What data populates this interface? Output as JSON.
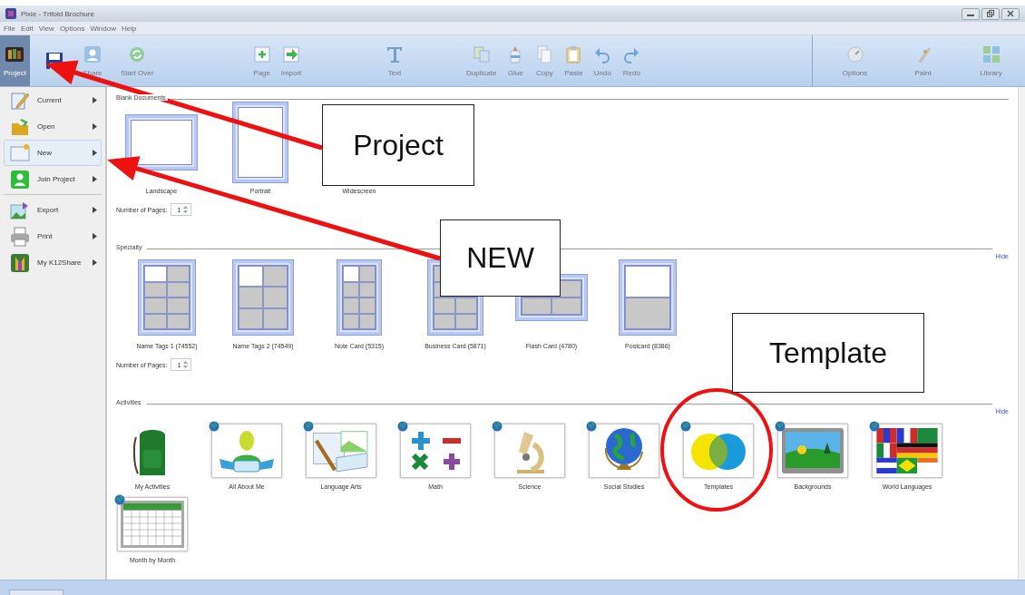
{
  "window": {
    "title": "Pixie - Trifold Brochure"
  },
  "menu": [
    "File",
    "Edit",
    "View",
    "Options",
    "Window",
    "Help"
  ],
  "toolbar": {
    "groups": [
      [
        {
          "label": "Project",
          "selected": true
        },
        {
          "selected": false
        },
        {
          "label": "Share",
          "selected": false
        },
        {
          "label": "Start Over",
          "selected": false
        }
      ],
      [
        {
          "label": "Page",
          "selected": false
        },
        {
          "label": "Import",
          "selected": false
        }
      ],
      [
        {
          "label": "Text",
          "selected": false
        }
      ],
      [
        {
          "label": "Duplicate",
          "selected": false
        },
        {
          "label": "Glue",
          "selected": false
        },
        {
          "label": "Copy",
          "selected": false
        },
        {
          "label": "Paste",
          "selected": false
        },
        {
          "label": "Undo",
          "selected": false
        },
        {
          "label": "Redo",
          "selected": false
        }
      ],
      [
        {
          "label": "Options",
          "selected": false
        },
        {
          "label": "Paint",
          "selected": false
        },
        {
          "label": "Library",
          "selected": false
        }
      ]
    ]
  },
  "project_menu": [
    {
      "label": "Current",
      "selected": false
    },
    {
      "label": "Open",
      "selected": false
    },
    {
      "label": "New",
      "selected": true
    },
    {
      "label": "Join Project",
      "selected": false
    },
    {
      "label": "Export",
      "selected": false
    },
    {
      "label": "Print",
      "selected": false
    },
    {
      "label": "My K12Share",
      "selected": false
    }
  ],
  "blank_documents": {
    "title": "Blank Documents",
    "items": [
      "Landscape",
      "Portrait",
      "Widescreen"
    ],
    "pages_label": "Number of Pages:",
    "pages_value": "1"
  },
  "specialty": {
    "title": "Specialty",
    "hide_link": "Hide",
    "items": [
      "Name Tags 1 (74552)",
      "Name Tags 2 (74549)",
      "Note Card (5315)",
      "Business Card (5871)",
      "Flash Card (4780)",
      "Postcard (8386)"
    ],
    "pages_label": "Number of Pages:",
    "pages_value": "1"
  },
  "activities": {
    "title": "Activities",
    "hide_link": "Hide",
    "items": [
      {
        "label": "My Activities",
        "web": false
      },
      {
        "label": "All About Me",
        "web": true
      },
      {
        "label": "Language Arts",
        "web": true
      },
      {
        "label": "Math",
        "web": true
      },
      {
        "label": "Science",
        "web": true
      },
      {
        "label": "Social Studies",
        "web": true
      },
      {
        "label": "Templates",
        "web": true
      },
      {
        "label": "Backgrounds",
        "web": true
      },
      {
        "label": "World Languages",
        "web": true
      },
      {
        "label": "Month by Month",
        "web": true
      }
    ]
  },
  "annotations": [
    {
      "text": "Project"
    },
    {
      "text": "NEW"
    },
    {
      "text": "Template"
    }
  ]
}
